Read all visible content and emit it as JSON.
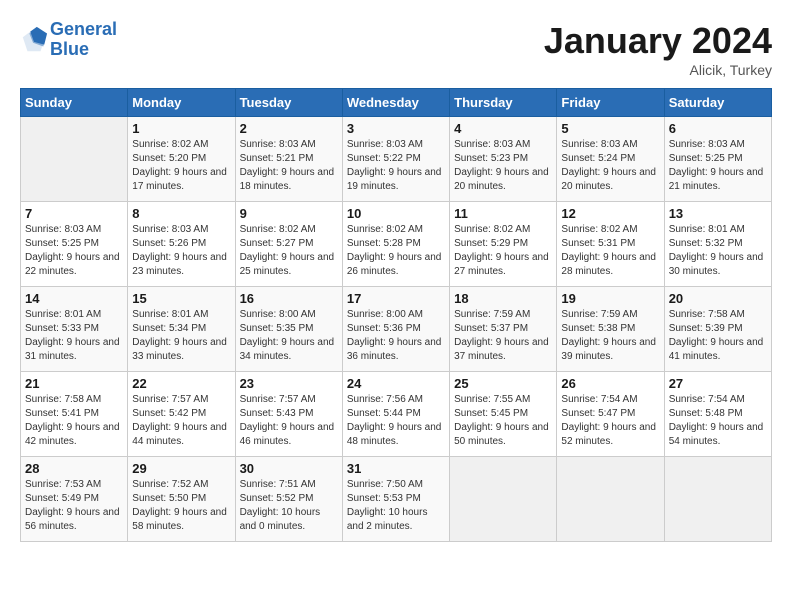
{
  "header": {
    "logo_line1": "General",
    "logo_line2": "Blue",
    "month": "January 2024",
    "location": "Alicik, Turkey"
  },
  "weekdays": [
    "Sunday",
    "Monday",
    "Tuesday",
    "Wednesday",
    "Thursday",
    "Friday",
    "Saturday"
  ],
  "weeks": [
    [
      {
        "day": "",
        "sunrise": "",
        "sunset": "",
        "daylight": ""
      },
      {
        "day": "1",
        "sunrise": "Sunrise: 8:02 AM",
        "sunset": "Sunset: 5:20 PM",
        "daylight": "Daylight: 9 hours and 17 minutes."
      },
      {
        "day": "2",
        "sunrise": "Sunrise: 8:03 AM",
        "sunset": "Sunset: 5:21 PM",
        "daylight": "Daylight: 9 hours and 18 minutes."
      },
      {
        "day": "3",
        "sunrise": "Sunrise: 8:03 AM",
        "sunset": "Sunset: 5:22 PM",
        "daylight": "Daylight: 9 hours and 19 minutes."
      },
      {
        "day": "4",
        "sunrise": "Sunrise: 8:03 AM",
        "sunset": "Sunset: 5:23 PM",
        "daylight": "Daylight: 9 hours and 20 minutes."
      },
      {
        "day": "5",
        "sunrise": "Sunrise: 8:03 AM",
        "sunset": "Sunset: 5:24 PM",
        "daylight": "Daylight: 9 hours and 20 minutes."
      },
      {
        "day": "6",
        "sunrise": "Sunrise: 8:03 AM",
        "sunset": "Sunset: 5:25 PM",
        "daylight": "Daylight: 9 hours and 21 minutes."
      }
    ],
    [
      {
        "day": "7",
        "sunrise": "Sunrise: 8:03 AM",
        "sunset": "Sunset: 5:25 PM",
        "daylight": "Daylight: 9 hours and 22 minutes."
      },
      {
        "day": "8",
        "sunrise": "Sunrise: 8:03 AM",
        "sunset": "Sunset: 5:26 PM",
        "daylight": "Daylight: 9 hours and 23 minutes."
      },
      {
        "day": "9",
        "sunrise": "Sunrise: 8:02 AM",
        "sunset": "Sunset: 5:27 PM",
        "daylight": "Daylight: 9 hours and 25 minutes."
      },
      {
        "day": "10",
        "sunrise": "Sunrise: 8:02 AM",
        "sunset": "Sunset: 5:28 PM",
        "daylight": "Daylight: 9 hours and 26 minutes."
      },
      {
        "day": "11",
        "sunrise": "Sunrise: 8:02 AM",
        "sunset": "Sunset: 5:29 PM",
        "daylight": "Daylight: 9 hours and 27 minutes."
      },
      {
        "day": "12",
        "sunrise": "Sunrise: 8:02 AM",
        "sunset": "Sunset: 5:31 PM",
        "daylight": "Daylight: 9 hours and 28 minutes."
      },
      {
        "day": "13",
        "sunrise": "Sunrise: 8:01 AM",
        "sunset": "Sunset: 5:32 PM",
        "daylight": "Daylight: 9 hours and 30 minutes."
      }
    ],
    [
      {
        "day": "14",
        "sunrise": "Sunrise: 8:01 AM",
        "sunset": "Sunset: 5:33 PM",
        "daylight": "Daylight: 9 hours and 31 minutes."
      },
      {
        "day": "15",
        "sunrise": "Sunrise: 8:01 AM",
        "sunset": "Sunset: 5:34 PM",
        "daylight": "Daylight: 9 hours and 33 minutes."
      },
      {
        "day": "16",
        "sunrise": "Sunrise: 8:00 AM",
        "sunset": "Sunset: 5:35 PM",
        "daylight": "Daylight: 9 hours and 34 minutes."
      },
      {
        "day": "17",
        "sunrise": "Sunrise: 8:00 AM",
        "sunset": "Sunset: 5:36 PM",
        "daylight": "Daylight: 9 hours and 36 minutes."
      },
      {
        "day": "18",
        "sunrise": "Sunrise: 7:59 AM",
        "sunset": "Sunset: 5:37 PM",
        "daylight": "Daylight: 9 hours and 37 minutes."
      },
      {
        "day": "19",
        "sunrise": "Sunrise: 7:59 AM",
        "sunset": "Sunset: 5:38 PM",
        "daylight": "Daylight: 9 hours and 39 minutes."
      },
      {
        "day": "20",
        "sunrise": "Sunrise: 7:58 AM",
        "sunset": "Sunset: 5:39 PM",
        "daylight": "Daylight: 9 hours and 41 minutes."
      }
    ],
    [
      {
        "day": "21",
        "sunrise": "Sunrise: 7:58 AM",
        "sunset": "Sunset: 5:41 PM",
        "daylight": "Daylight: 9 hours and 42 minutes."
      },
      {
        "day": "22",
        "sunrise": "Sunrise: 7:57 AM",
        "sunset": "Sunset: 5:42 PM",
        "daylight": "Daylight: 9 hours and 44 minutes."
      },
      {
        "day": "23",
        "sunrise": "Sunrise: 7:57 AM",
        "sunset": "Sunset: 5:43 PM",
        "daylight": "Daylight: 9 hours and 46 minutes."
      },
      {
        "day": "24",
        "sunrise": "Sunrise: 7:56 AM",
        "sunset": "Sunset: 5:44 PM",
        "daylight": "Daylight: 9 hours and 48 minutes."
      },
      {
        "day": "25",
        "sunrise": "Sunrise: 7:55 AM",
        "sunset": "Sunset: 5:45 PM",
        "daylight": "Daylight: 9 hours and 50 minutes."
      },
      {
        "day": "26",
        "sunrise": "Sunrise: 7:54 AM",
        "sunset": "Sunset: 5:47 PM",
        "daylight": "Daylight: 9 hours and 52 minutes."
      },
      {
        "day": "27",
        "sunrise": "Sunrise: 7:54 AM",
        "sunset": "Sunset: 5:48 PM",
        "daylight": "Daylight: 9 hours and 54 minutes."
      }
    ],
    [
      {
        "day": "28",
        "sunrise": "Sunrise: 7:53 AM",
        "sunset": "Sunset: 5:49 PM",
        "daylight": "Daylight: 9 hours and 56 minutes."
      },
      {
        "day": "29",
        "sunrise": "Sunrise: 7:52 AM",
        "sunset": "Sunset: 5:50 PM",
        "daylight": "Daylight: 9 hours and 58 minutes."
      },
      {
        "day": "30",
        "sunrise": "Sunrise: 7:51 AM",
        "sunset": "Sunset: 5:52 PM",
        "daylight": "Daylight: 10 hours and 0 minutes."
      },
      {
        "day": "31",
        "sunrise": "Sunrise: 7:50 AM",
        "sunset": "Sunset: 5:53 PM",
        "daylight": "Daylight: 10 hours and 2 minutes."
      },
      {
        "day": "",
        "sunrise": "",
        "sunset": "",
        "daylight": ""
      },
      {
        "day": "",
        "sunrise": "",
        "sunset": "",
        "daylight": ""
      },
      {
        "day": "",
        "sunrise": "",
        "sunset": "",
        "daylight": ""
      }
    ]
  ]
}
